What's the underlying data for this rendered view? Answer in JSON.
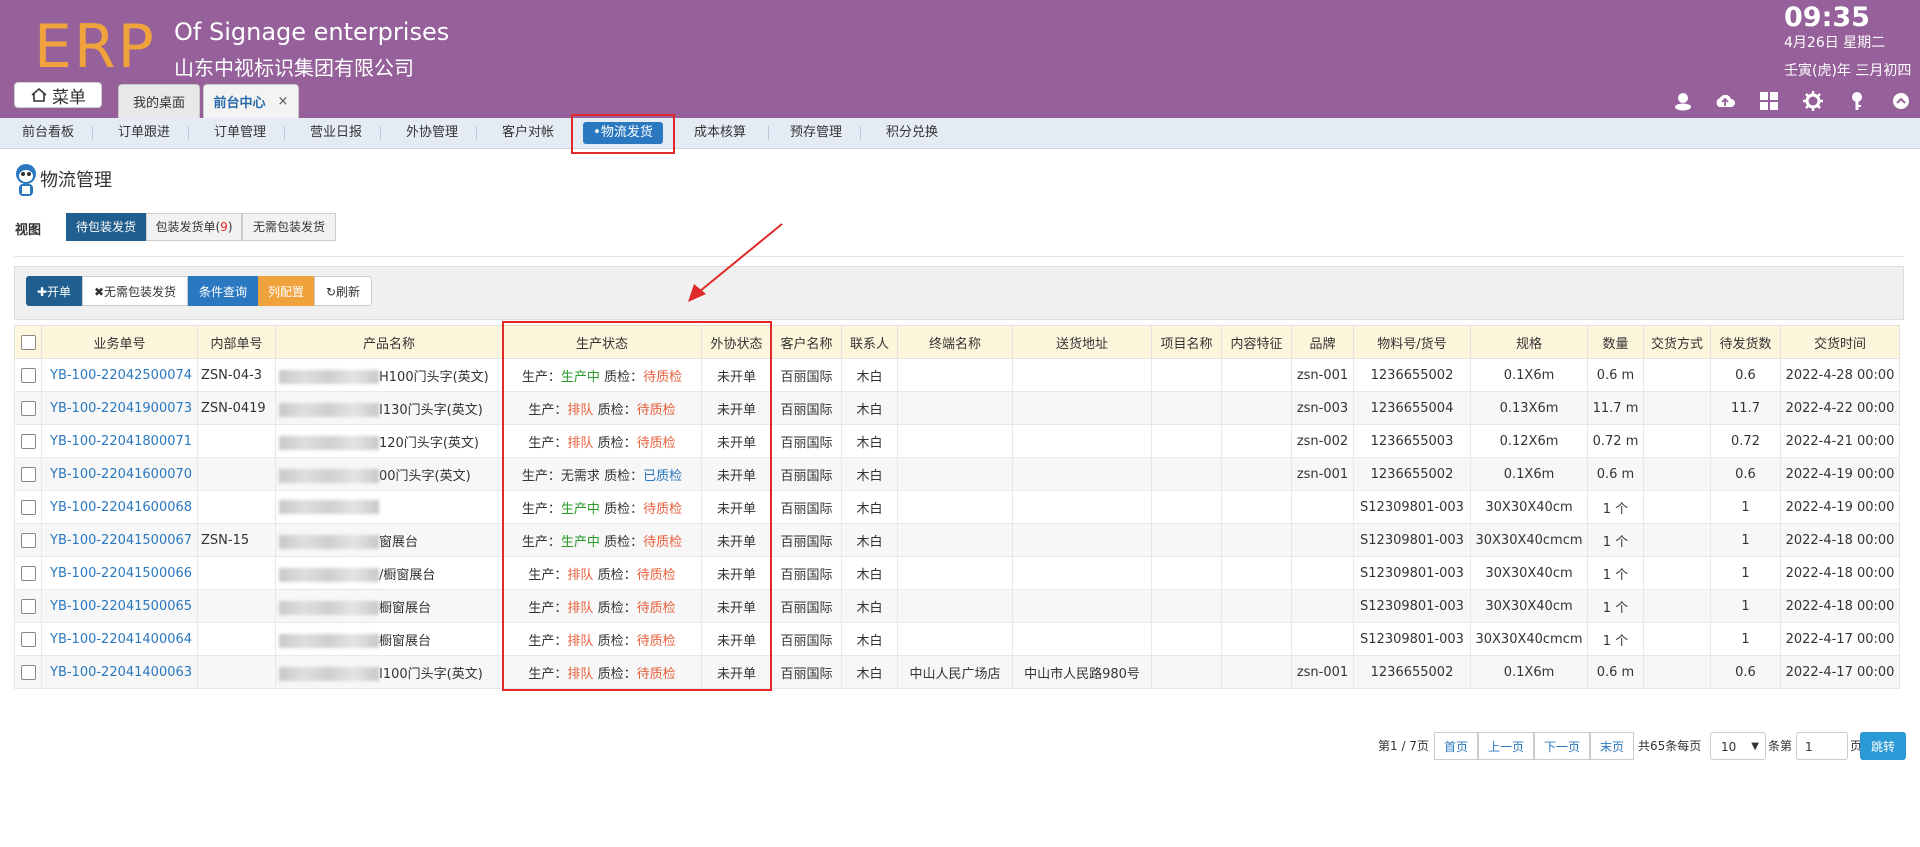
{
  "header": {
    "logo": "ERP",
    "company_en": "Of Signage enterprises",
    "company_cn": "山东中视标识集团有限公司",
    "time": "09:35",
    "date": "4月26日 星期二",
    "lunar": "壬寅(虎)年 三月初四",
    "menu_label": "菜单",
    "tabs": [
      {
        "label": "我的桌面"
      },
      {
        "label": "前台中心",
        "close": "×"
      }
    ],
    "icons": [
      "user-icon",
      "cloud-upload-icon",
      "grid-icon",
      "gear-icon",
      "key-icon",
      "chevron-up-icon"
    ]
  },
  "nav": {
    "items": [
      "前台看板",
      "订单跟进",
      "订单管理",
      "营业日报",
      "外协管理",
      "客户对帐",
      "•物流发货",
      "成本核算",
      "预存管理",
      "积分兑换"
    ],
    "active_index": 6
  },
  "page": {
    "title": "物流管理",
    "view_label": "视图",
    "view_tabs": [
      {
        "label": "待包装发货"
      },
      {
        "label": "包装发货单(",
        "count": "9",
        "suffix": ")"
      },
      {
        "label": "无需包装发货"
      }
    ]
  },
  "toolbar": {
    "open": "开单",
    "no_pack": "无需包装发货",
    "query": "条件查询",
    "columns": "列配置",
    "refresh": "刷新"
  },
  "table": {
    "headers": [
      "业务单号",
      "内部单号",
      "产品名称",
      "生产状态",
      "外协状态",
      "客户名称",
      "联系人",
      "终端名称",
      "送货地址",
      "项目名称",
      "内容特征",
      "品牌",
      "物料号/货号",
      "规格",
      "数量",
      "交货方式",
      "待发货数",
      "交货时间"
    ],
    "status_labels": {
      "prod": "生产：",
      "qc": "质检："
    },
    "rows": [
      {
        "order_no": "YB-100-22042500074",
        "inner_no": "ZSN-04-3",
        "product": "H100门头字(英文)",
        "prod_status": "生产中",
        "qc_status": "待质检",
        "wx_status": "未开单",
        "customer": "百丽国际",
        "contact": "木白",
        "terminal": "",
        "address": "",
        "project": "",
        "feature": "",
        "brand": "zsn-001",
        "material": "1236655002",
        "spec": "0.1X6m",
        "qty": "0.6 m",
        "delivery": "",
        "pending": "0.6",
        "date": "2022-4-28 00:00"
      },
      {
        "order_no": "YB-100-22041900073",
        "inner_no": "ZSN-0419",
        "product": "I130门头字(英文)",
        "prod_status": "排队",
        "qc_status": "待质检",
        "wx_status": "未开单",
        "customer": "百丽国际",
        "contact": "木白",
        "terminal": "",
        "address": "",
        "project": "",
        "feature": "",
        "brand": "zsn-003",
        "material": "1236655004",
        "spec": "0.13X6m",
        "qty": "11.7 m",
        "delivery": "",
        "pending": "11.7",
        "date": "2022-4-22 00:00"
      },
      {
        "order_no": "YB-100-22041800071",
        "inner_no": "",
        "product": "120门头字(英文)",
        "prod_status": "排队",
        "qc_status": "待质检",
        "wx_status": "未开单",
        "customer": "百丽国际",
        "contact": "木白",
        "terminal": "",
        "address": "",
        "project": "",
        "feature": "",
        "brand": "zsn-002",
        "material": "1236655003",
        "spec": "0.12X6m",
        "qty": "0.72 m",
        "delivery": "",
        "pending": "0.72",
        "date": "2022-4-21 00:00"
      },
      {
        "order_no": "YB-100-22041600070",
        "inner_no": "",
        "product": "00门头字(英文)",
        "prod_status": "无需求",
        "qc_status": "已质检",
        "wx_status": "未开单",
        "customer": "百丽国际",
        "contact": "木白",
        "terminal": "",
        "address": "",
        "project": "",
        "feature": "",
        "brand": "zsn-001",
        "material": "1236655002",
        "spec": "0.1X6m",
        "qty": "0.6 m",
        "delivery": "",
        "pending": "0.6",
        "date": "2022-4-19 00:00"
      },
      {
        "order_no": "YB-100-22041600068",
        "inner_no": "",
        "product": "",
        "prod_status": "生产中",
        "qc_status": "待质检",
        "wx_status": "未开单",
        "customer": "百丽国际",
        "contact": "木白",
        "terminal": "",
        "address": "",
        "project": "",
        "feature": "",
        "brand": "",
        "material": "S12309801-003",
        "spec": "30X30X40cm",
        "qty": "1 个",
        "delivery": "",
        "pending": "1",
        "date": "2022-4-19 00:00"
      },
      {
        "order_no": "YB-100-22041500067",
        "inner_no": "ZSN-15",
        "product": "窗展台",
        "prod_status": "生产中",
        "qc_status": "待质检",
        "wx_status": "未开单",
        "customer": "百丽国际",
        "contact": "木白",
        "terminal": "",
        "address": "",
        "project": "",
        "feature": "",
        "brand": "",
        "material": "S12309801-003",
        "spec": "30X30X40cmcm",
        "qty": "1 个",
        "delivery": "",
        "pending": "1",
        "date": "2022-4-18 00:00"
      },
      {
        "order_no": "YB-100-22041500066",
        "inner_no": "",
        "product": "/橱窗展台",
        "prod_status": "排队",
        "qc_status": "待质检",
        "wx_status": "未开单",
        "customer": "百丽国际",
        "contact": "木白",
        "terminal": "",
        "address": "",
        "project": "",
        "feature": "",
        "brand": "",
        "material": "S12309801-003",
        "spec": "30X30X40cm",
        "qty": "1 个",
        "delivery": "",
        "pending": "1",
        "date": "2022-4-18 00:00"
      },
      {
        "order_no": "YB-100-22041500065",
        "inner_no": "",
        "product": "橱窗展台",
        "prod_status": "排队",
        "qc_status": "待质检",
        "wx_status": "未开单",
        "customer": "百丽国际",
        "contact": "木白",
        "terminal": "",
        "address": "",
        "project": "",
        "feature": "",
        "brand": "",
        "material": "S12309801-003",
        "spec": "30X30X40cm",
        "qty": "1 个",
        "delivery": "",
        "pending": "1",
        "date": "2022-4-18 00:00"
      },
      {
        "order_no": "YB-100-22041400064",
        "inner_no": "",
        "product": "橱窗展台",
        "prod_status": "排队",
        "qc_status": "待质检",
        "wx_status": "未开单",
        "customer": "百丽国际",
        "contact": "木白",
        "terminal": "",
        "address": "",
        "project": "",
        "feature": "",
        "brand": "",
        "material": "S12309801-003",
        "spec": "30X30X40cmcm",
        "qty": "1 个",
        "delivery": "",
        "pending": "1",
        "date": "2022-4-17 00:00"
      },
      {
        "order_no": "YB-100-22041400063",
        "inner_no": "",
        "product": "I100门头字(英文)",
        "prod_status": "排队",
        "qc_status": "待质检",
        "wx_status": "未开单",
        "customer": "百丽国际",
        "contact": "木白",
        "terminal": "中山人民广场店",
        "address": "中山市人民路980号",
        "project": "",
        "feature": "",
        "brand": "zsn-001",
        "material": "1236655002",
        "spec": "0.1X6m",
        "qty": "0.6 m",
        "delivery": "",
        "pending": "0.6",
        "date": "2022-4-17 00:00"
      }
    ]
  },
  "pagination": {
    "page_info": "第1 / 7页",
    "first": "首页",
    "prev": "上一页",
    "next": "下一页",
    "last": "末页",
    "total_text": "共65条每页",
    "page_size": "10",
    "unit_text": "条第",
    "page_input": "1",
    "page_suffix": "页",
    "go": "跳转"
  },
  "colors": {
    "header_bg": "#96609a",
    "logo": "#f0a23c",
    "accent_blue": "#2a78c0",
    "highlight_red": "#e02a2a",
    "status_green": "#2a9a2a",
    "status_orange": "#e8603c"
  }
}
